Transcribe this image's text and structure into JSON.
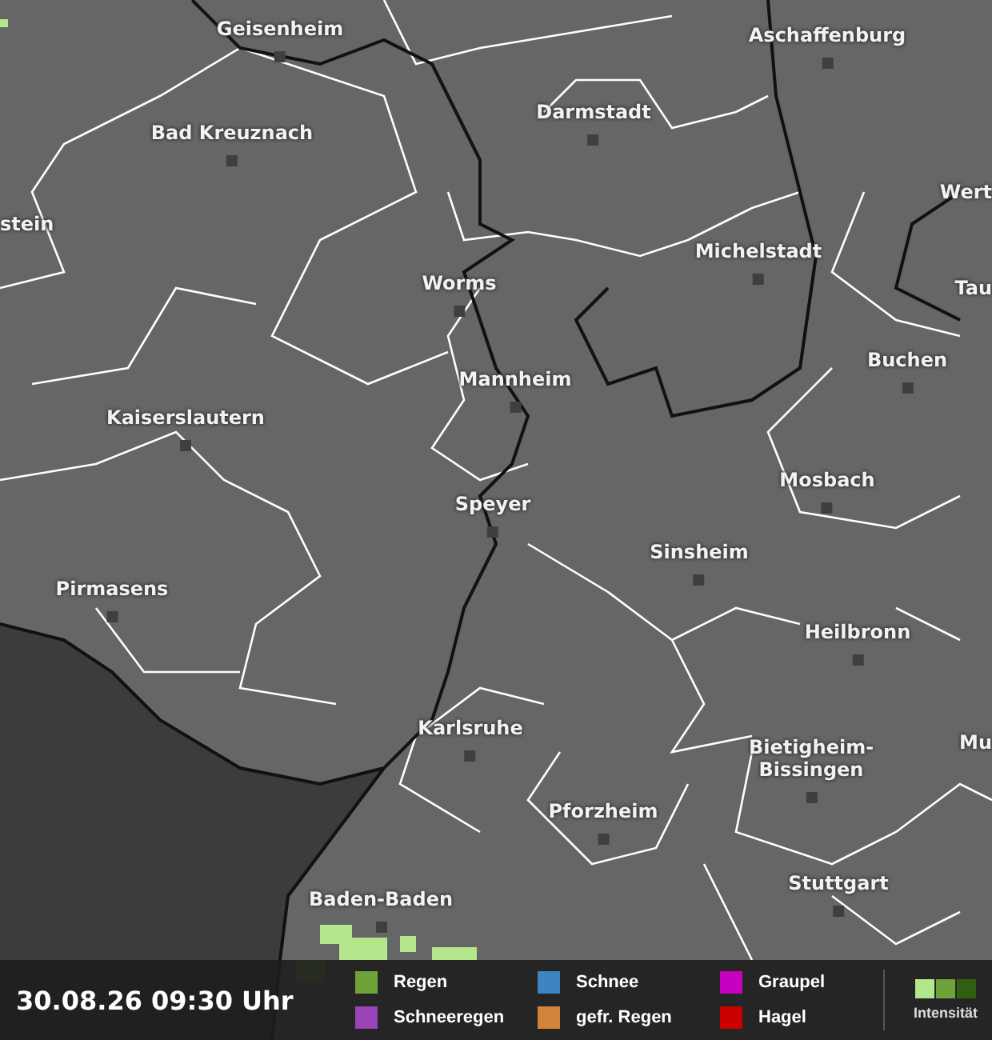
{
  "map": {
    "cities": [
      {
        "name": "Geisenheim",
        "dot": true
      },
      {
        "name": "Aschaffenburg",
        "dot": true
      },
      {
        "name": "Darmstadt",
        "dot": true
      },
      {
        "name": "Bad Kreuznach",
        "dot": true
      },
      {
        "name": "Wert",
        "dot": false
      },
      {
        "name": "stein",
        "dot": false
      },
      {
        "name": "Michelstadt",
        "dot": true
      },
      {
        "name": "Worms",
        "dot": true
      },
      {
        "name": "Tau",
        "dot": false
      },
      {
        "name": "Buchen",
        "dot": true
      },
      {
        "name": "Mannheim",
        "dot": true
      },
      {
        "name": "Kaiserslautern",
        "dot": true
      },
      {
        "name": "Mosbach",
        "dot": true
      },
      {
        "name": "Speyer",
        "dot": true
      },
      {
        "name": "Sinsheim",
        "dot": true
      },
      {
        "name": "Pirmasens",
        "dot": true
      },
      {
        "name": "Heilbronn",
        "dot": true
      },
      {
        "name": "Karlsruhe",
        "dot": true
      },
      {
        "name": "Mu",
        "dot": false
      },
      {
        "name": "Bietigheim-\nBissingen",
        "dot": true
      },
      {
        "name": "Pforzheim",
        "dot": true
      },
      {
        "name": "Stuttgart",
        "dot": true
      },
      {
        "name": "Baden-Baden",
        "dot": true
      }
    ]
  },
  "legend": {
    "timestamp": "30.08.26 09:30 Uhr",
    "types": [
      {
        "label": "Regen",
        "color": "#6fa33a"
      },
      {
        "label": "Schneeregen",
        "color": "#9a44b8"
      },
      {
        "label": "Schnee",
        "color": "#3d85c0"
      },
      {
        "label": "gefr. Regen",
        "color": "#d3843a"
      },
      {
        "label": "Graupel",
        "color": "#c800c0"
      },
      {
        "label": "Hagel",
        "color": "#cc0000"
      }
    ],
    "intensity": {
      "label": "Intensität",
      "steps": [
        {
          "color": "#b4e68c"
        },
        {
          "color": "#6fa33a"
        },
        {
          "color": "#2f5f10"
        }
      ]
    }
  }
}
